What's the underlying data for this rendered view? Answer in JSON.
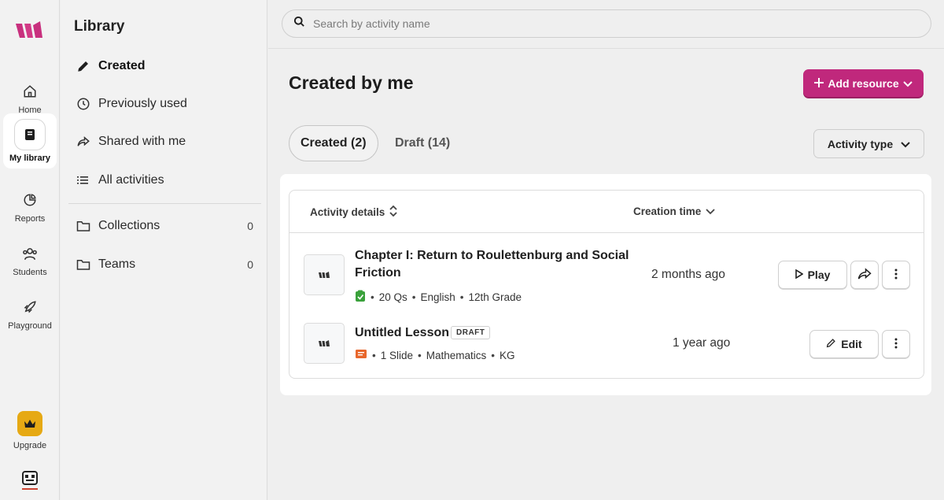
{
  "rail": {
    "items": [
      {
        "label": "Home",
        "icon": "home-icon"
      },
      {
        "label": "My library",
        "icon": "book-icon",
        "active": true
      },
      {
        "label": "Reports",
        "icon": "pie-chart-icon"
      },
      {
        "label": "Students",
        "icon": "users-icon"
      },
      {
        "label": "Playground",
        "icon": "rocket-icon"
      }
    ],
    "upgrade_label": "Upgrade"
  },
  "library": {
    "title": "Library",
    "items": [
      {
        "label": "Created",
        "icon": "pencil-icon",
        "active": true
      },
      {
        "label": "Previously used",
        "icon": "clock-icon"
      },
      {
        "label": "Shared with me",
        "icon": "share-icon"
      },
      {
        "label": "All activities",
        "icon": "list-icon"
      }
    ],
    "folders": [
      {
        "label": "Collections",
        "count": "0",
        "icon": "folder-icon"
      },
      {
        "label": "Teams",
        "count": "0",
        "icon": "folder-icon"
      }
    ]
  },
  "search": {
    "placeholder": "Search by activity name"
  },
  "page": {
    "title": "Created by me",
    "add_resource_label": "Add resource",
    "tabs": [
      {
        "label": "Created (2)",
        "active": true
      },
      {
        "label": "Draft (14)",
        "active": false
      }
    ],
    "activity_type_label": "Activity type"
  },
  "table": {
    "columns": {
      "details": "Activity details",
      "time": "Creation time"
    },
    "rows": [
      {
        "title_line1": "Chapter I: Return to Roulettenburg and Social",
        "title_line2": "Friction",
        "meta": [
          "20 Qs",
          "English",
          "12th Grade"
        ],
        "type_icon": "quiz-icon",
        "time": "2 months ago",
        "primary_action": "Play"
      },
      {
        "title_line1": "Untitled Lesson",
        "badge": "DRAFT",
        "meta": [
          "1 Slide",
          "Mathematics",
          "KG"
        ],
        "type_icon": "lesson-icon",
        "time": "1 year ago",
        "primary_action": "Edit"
      }
    ]
  },
  "colors": {
    "brand": "#c0287c",
    "quiz_icon": "#3aa13b",
    "lesson_icon": "#e8672c",
    "upgrade": "#e6a914"
  }
}
